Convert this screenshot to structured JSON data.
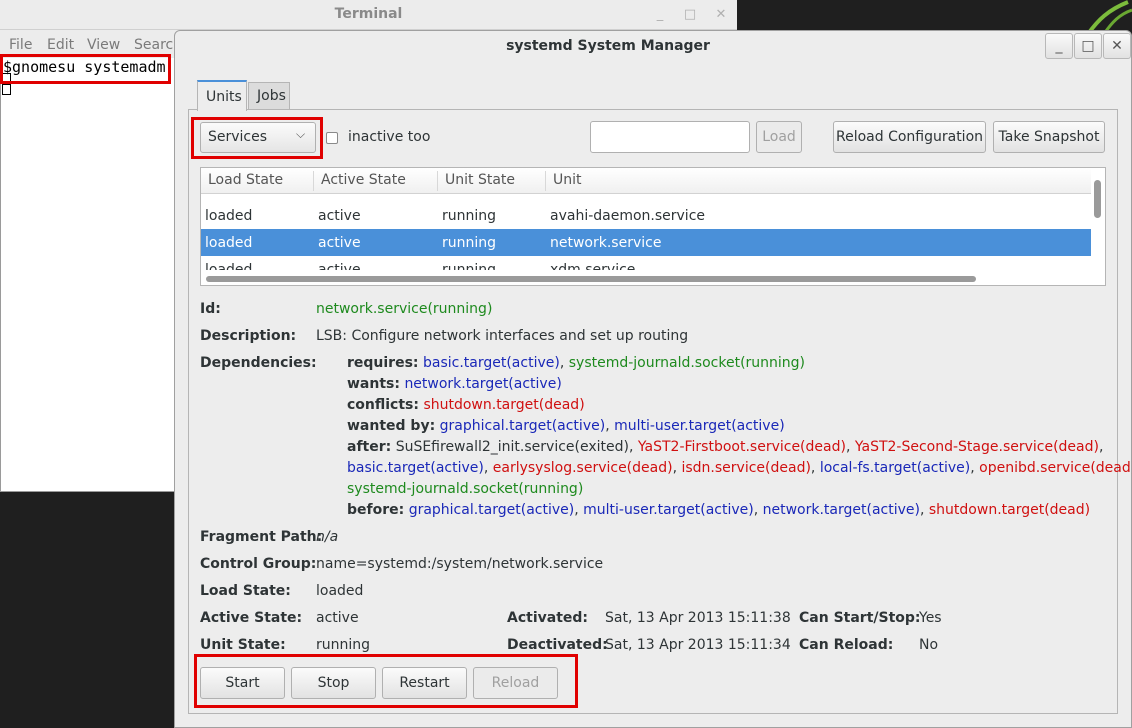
{
  "terminal": {
    "title": "Terminal",
    "menu": [
      "File",
      "Edit",
      "View",
      "Search"
    ],
    "command": "$gnomesu systemadm",
    "controls": [
      "_",
      "□",
      "✕"
    ]
  },
  "window": {
    "title": "systemd System Manager",
    "controls": [
      "_",
      "□",
      "✕"
    ]
  },
  "tabs": [
    "Units",
    "Jobs"
  ],
  "toolbar": {
    "filter_value": "Services",
    "inactive_label": "inactive too",
    "search_value": "",
    "load_label": "Load",
    "reload_config_label": "Reload Configuration",
    "snapshot_label": "Take Snapshot"
  },
  "unit_list": {
    "columns": [
      "Load State",
      "Active State",
      "Unit State",
      "Unit"
    ],
    "rows": [
      {
        "load": "loaded",
        "active": "active",
        "unit_state": "running",
        "unit": "avahi-daemon.service",
        "selected": false
      },
      {
        "load": "loaded",
        "active": "active",
        "unit_state": "running",
        "unit": "network.service",
        "selected": true
      },
      {
        "load": "loaded",
        "active": "active",
        "unit_state": "running",
        "unit": "xdm.service",
        "selected": false
      }
    ]
  },
  "details": {
    "id_label": "Id:",
    "id_value": "network.service(running)",
    "description_label": "Description:",
    "description_value": "LSB: Configure network interfaces and set up routing",
    "dependencies_label": "Dependencies:",
    "dependencies": {
      "requires_label": "requires:",
      "requires": [
        {
          "text": "basic.target(active)",
          "state": "active"
        },
        {
          "text": "systemd-journald.socket(running)",
          "state": "running"
        }
      ],
      "wants_label": "wants:",
      "wants": [
        {
          "text": "network.target(active)",
          "state": "active"
        }
      ],
      "conflicts_label": "conflicts:",
      "conflicts": [
        {
          "text": "shutdown.target(dead)",
          "state": "dead"
        }
      ],
      "wanted_by_label": "wanted by:",
      "wanted_by": [
        {
          "text": "graphical.target(active)",
          "state": "active"
        },
        {
          "text": "multi-user.target(active)",
          "state": "active"
        }
      ],
      "after_label": "after:",
      "after_line1": [
        {
          "text": "SuSEfirewall2_init.service(exited)",
          "state": "exited"
        },
        {
          "text": "YaST2-Firstboot.service(dead)",
          "state": "dead"
        },
        {
          "text": "YaST2-Second-Stage.service(dead)",
          "state": "dead"
        }
      ],
      "after_line2": [
        {
          "text": "basic.target(active)",
          "state": "active"
        },
        {
          "text": "earlysyslog.service(dead)",
          "state": "dead"
        },
        {
          "text": "isdn.service(dead)",
          "state": "dead"
        },
        {
          "text": "local-fs.target(active)",
          "state": "active"
        },
        {
          "text": "openibd.service(dead)",
          "state": "dead"
        }
      ],
      "after_line3": [
        {
          "text": "systemd-journald.socket(running)",
          "state": "running"
        }
      ],
      "before_label": "before:",
      "before": [
        {
          "text": "graphical.target(active)",
          "state": "active"
        },
        {
          "text": "multi-user.target(active)",
          "state": "active"
        },
        {
          "text": "network.target(active)",
          "state": "active"
        },
        {
          "text": "shutdown.target(dead)",
          "state": "dead"
        }
      ]
    },
    "fragment_path_label": "Fragment Path:",
    "fragment_path_value": "n/a",
    "control_group_label": "Control Group:",
    "control_group_value": "name=systemd:/system/network.service",
    "load_state_label": "Load State:",
    "load_state_value": "loaded",
    "active_state_label": "Active State:",
    "active_state_value": "active",
    "unit_state_label": "Unit State:",
    "unit_state_value": "running",
    "activated_label": "Activated:",
    "activated_value": "Sat, 13 Apr 2013 15:11:38",
    "deactivated_label": "Deactivated:",
    "deactivated_value": "Sat, 13 Apr 2013 15:11:34",
    "can_start_stop_label": "Can Start/Stop:",
    "can_start_stop_value": "Yes",
    "can_reload_label": "Can Reload:",
    "can_reload_value": "No"
  },
  "actions": {
    "start": "Start",
    "stop": "Stop",
    "restart": "Restart",
    "reload": "Reload"
  },
  "colors": {
    "highlight_outline": "#e00000",
    "selection": "#4a90d9",
    "state_running": "#1e8a1e",
    "state_active": "#1a28b8",
    "state_dead": "#d01010"
  }
}
